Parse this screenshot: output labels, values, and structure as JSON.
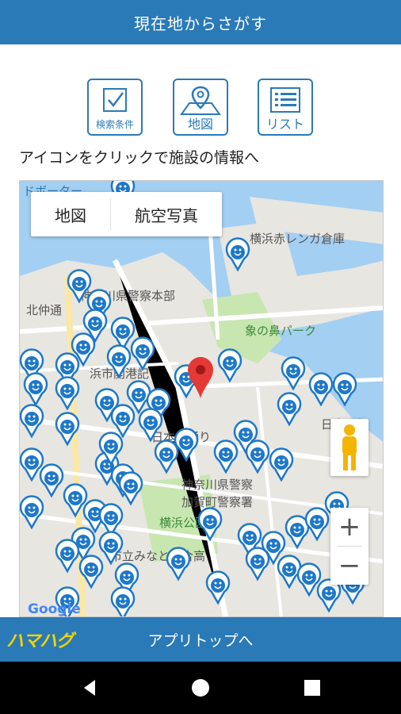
{
  "header": {
    "title": "現在地からさがす"
  },
  "toolbar": {
    "search_conditions": "検索条件",
    "map": "地図",
    "list": "リスト"
  },
  "instruction": "アイコンをクリックで施設の情報へ",
  "map": {
    "type_map": "地図",
    "type_aerial": "航空写真",
    "labels": {
      "label1": "ドボーター",
      "label2": "横浜赤レンガ倉庫",
      "label3": "神奈川県警察本部",
      "label4": "北仲通",
      "label5": "象の鼻パーク",
      "label6": "浜市開港記",
      "label7": "日本大通り",
      "label8": "神奈川県警察",
      "label9": "加賀町警察署",
      "label10": "横浜公園",
      "label11": "市立みなと総合高",
      "label12": "日本郵船"
    },
    "google": "Google",
    "zoom_in": "+",
    "zoom_out": "−"
  },
  "footer": {
    "logo": "ハマハグ",
    "app_top": "アプリトップへ"
  },
  "colors": {
    "primary": "#2a7ab8",
    "logo": "#f3d400",
    "pin": "#1e78c8",
    "water": "#a3cff2"
  }
}
